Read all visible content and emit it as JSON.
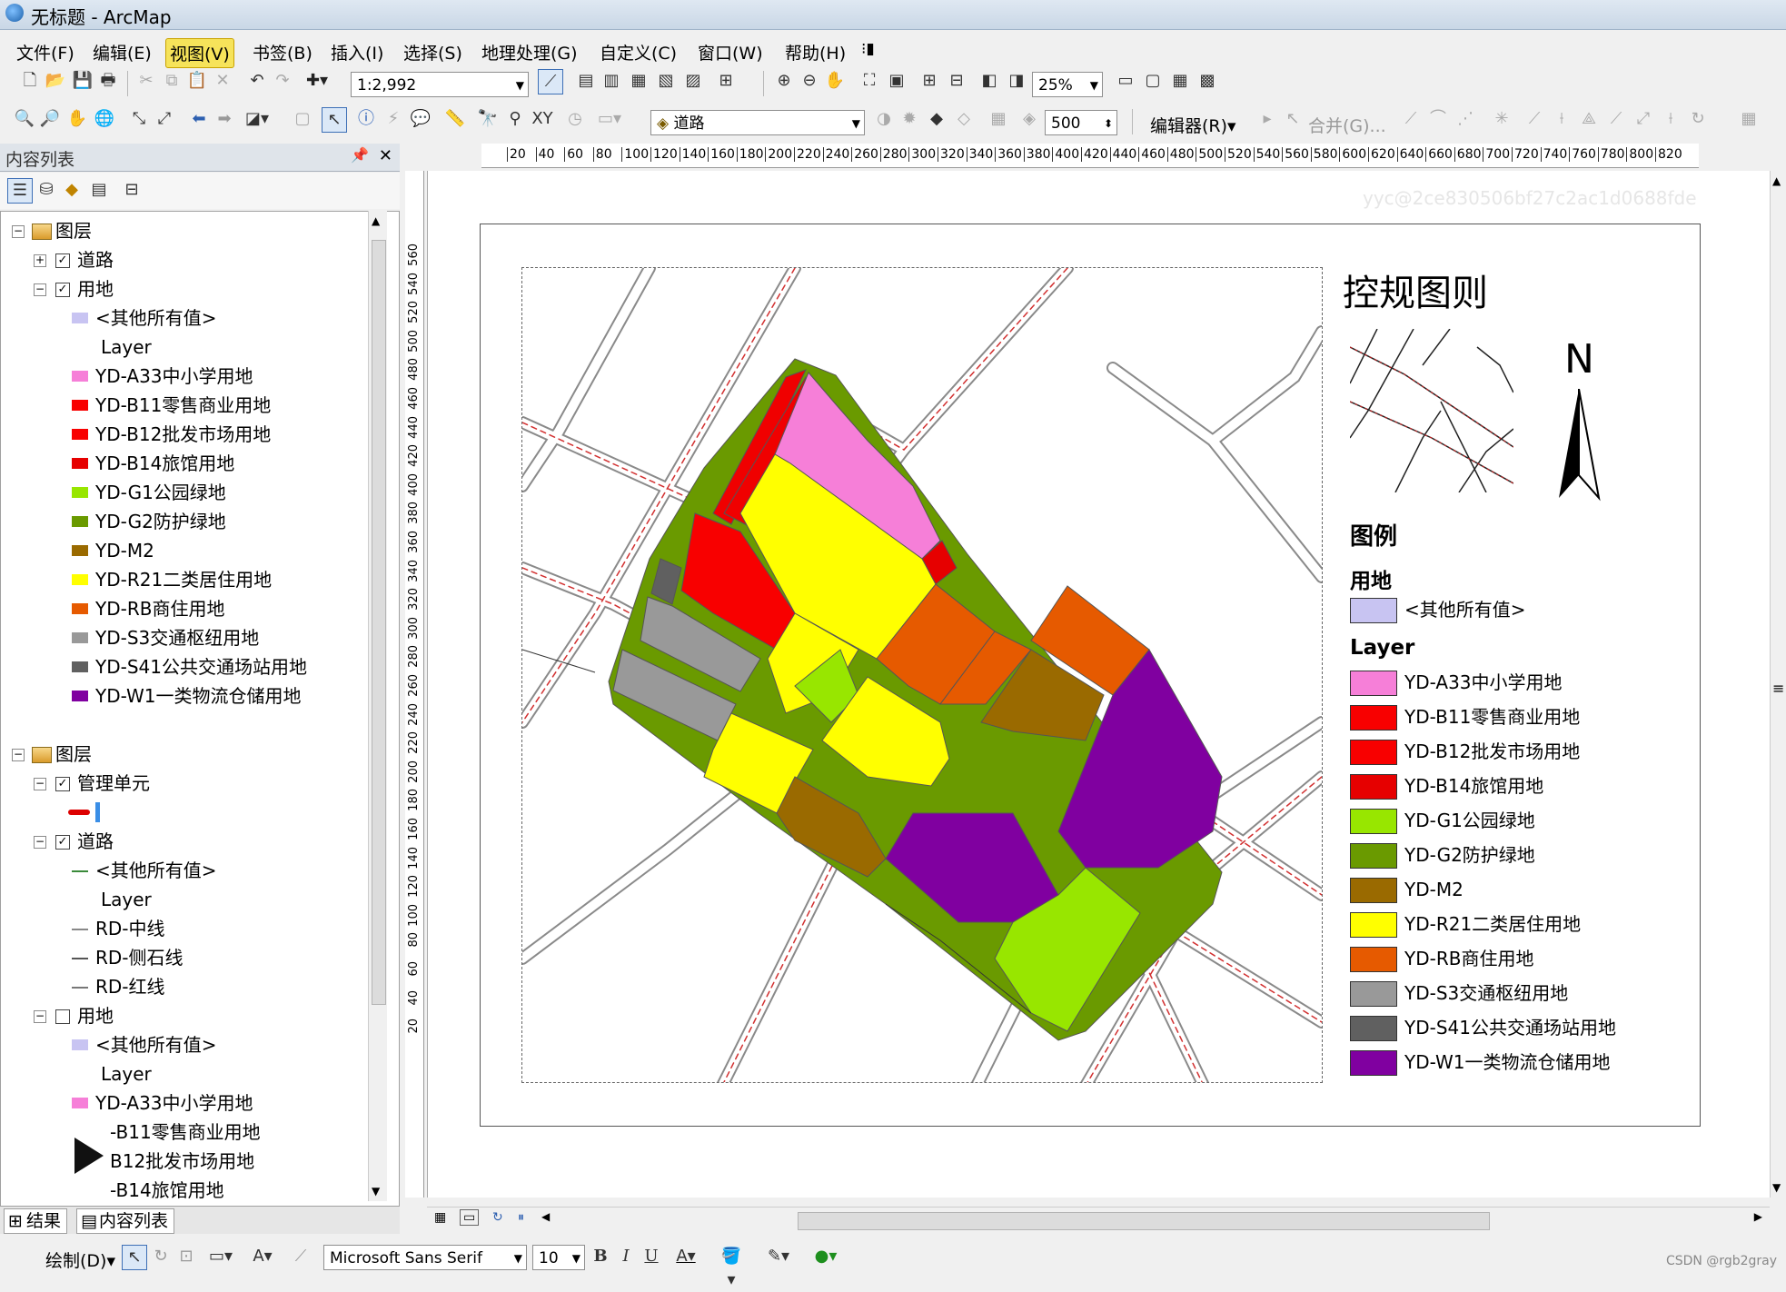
{
  "window": {
    "title": "无标题 - ArcMap"
  },
  "menu": [
    "文件(F)",
    "编辑(E)",
    "视图(V)",
    "书签(B)",
    "插入(I)",
    "选择(S)",
    "地理处理(G)",
    "自定义(C)",
    "窗口(W)",
    "帮助(H)"
  ],
  "menu_active_index": 2,
  "toolbar": {
    "scale": "1:2,992",
    "zoom": "25%",
    "layer_select": "道路",
    "offset_value": "500",
    "editor_label": "编辑器(R)",
    "merge_label": "合并(G)..."
  },
  "toc": {
    "title": "内容列表",
    "rows": [
      {
        "label": "图层",
        "kind": "group",
        "level": 0,
        "expander": "−"
      },
      {
        "label": "道路",
        "kind": "layer",
        "level": 1,
        "expander": "+",
        "checked": true
      },
      {
        "label": "用地",
        "kind": "layer",
        "level": 1,
        "expander": "−",
        "checked": true
      },
      {
        "label": "<其他所有值>",
        "kind": "class",
        "color": "#c8c4f2"
      },
      {
        "label": "Layer",
        "kind": "heading"
      },
      {
        "label": "YD-A33中小学用地",
        "kind": "class",
        "color": "#f67fd8"
      },
      {
        "label": "YD-B11零售商业用地",
        "kind": "class",
        "color": "#f80000"
      },
      {
        "label": "YD-B12批发市场用地",
        "kind": "class",
        "color": "#f80000"
      },
      {
        "label": "YD-B14旅馆用地",
        "kind": "class",
        "color": "#e60000"
      },
      {
        "label": "YD-G1公园绿地",
        "kind": "class",
        "color": "#98e600"
      },
      {
        "label": "YD-G2防护绿地",
        "kind": "class",
        "color": "#6a9a00"
      },
      {
        "label": "YD-M2",
        "kind": "class",
        "color": "#9a6a00"
      },
      {
        "label": "YD-R21二类居住用地",
        "kind": "class",
        "color": "#ffff00"
      },
      {
        "label": "YD-RB商住用地",
        "kind": "class",
        "color": "#e65a00"
      },
      {
        "label": "YD-S3交通枢纽用地",
        "kind": "class",
        "color": "#999999"
      },
      {
        "label": "YD-S41公共交通场站用地",
        "kind": "class",
        "color": "#606060"
      },
      {
        "label": "YD-W1一类物流仓储用地",
        "kind": "class",
        "color": "#8000a0"
      },
      {
        "label": "",
        "kind": "blank"
      },
      {
        "label": "图层",
        "kind": "group",
        "level": 0,
        "expander": "−"
      },
      {
        "label": "管理单元",
        "kind": "layer",
        "level": 1,
        "expander": "−",
        "checked": true
      },
      {
        "label": "",
        "kind": "marker"
      },
      {
        "label": "道路",
        "kind": "layer",
        "level": 1,
        "expander": "−",
        "checked": true
      },
      {
        "label": "<其他所有值>",
        "kind": "line",
        "color": "#3a8a3a"
      },
      {
        "label": "Layer",
        "kind": "heading"
      },
      {
        "label": "RD-中线",
        "kind": "line",
        "color": "#ffffff"
      },
      {
        "label": "RD-侧石线",
        "kind": "line",
        "color": "#555555"
      },
      {
        "label": "RD-红线",
        "kind": "line",
        "color": "#777777"
      },
      {
        "label": "用地",
        "kind": "layer",
        "level": 1,
        "expander": "−",
        "checked": false
      },
      {
        "label": "<其他所有值>",
        "kind": "class",
        "color": "#c8c4f2"
      },
      {
        "label": "Layer",
        "kind": "heading"
      },
      {
        "label": "YD-A33中小学用地",
        "kind": "class",
        "color": "#f67fd8"
      },
      {
        "label": "-B11零售商业用地",
        "kind": "class",
        "color": ""
      },
      {
        "label": "B12批发市场用地",
        "kind": "class",
        "color": ""
      },
      {
        "label": "-B14旅馆用地",
        "kind": "class",
        "color": ""
      }
    ],
    "bottom_tabs": [
      "结果",
      "内容列表"
    ]
  },
  "ruler": {
    "h_ticks": [
      "20",
      "40",
      "60",
      "80",
      "100",
      "120",
      "140",
      "160",
      "180",
      "200",
      "220",
      "240",
      "260",
      "280",
      "300",
      "320",
      "340",
      "360",
      "380",
      "400",
      "420",
      "440",
      "460",
      "480",
      "500",
      "520",
      "540",
      "560",
      "580",
      "600",
      "620",
      "640",
      "660",
      "680",
      "700",
      "720",
      "740",
      "760",
      "780",
      "800",
      "820"
    ],
    "v_ticks": [
      "560",
      "540",
      "520",
      "500",
      "480",
      "460",
      "440",
      "420",
      "400",
      "380",
      "360",
      "340",
      "320",
      "300",
      "280",
      "260",
      "240",
      "220",
      "200",
      "180",
      "160",
      "140",
      "120",
      "100",
      "80",
      "60",
      "40",
      "20"
    ]
  },
  "map": {
    "title": "控规图则",
    "north_label": "N",
    "legend_heading": "图例",
    "legend_group": "用地",
    "legend_other": {
      "label": "<其他所有值>",
      "color": "#c8c4f2"
    },
    "legend_layer_heading": "Layer",
    "legend_items": [
      {
        "label": "YD-A33中小学用地",
        "color": "#f67fd8"
      },
      {
        "label": "YD-B11零售商业用地",
        "color": "#f80000"
      },
      {
        "label": "YD-B12批发市场用地",
        "color": "#f80000"
      },
      {
        "label": "YD-B14旅馆用地",
        "color": "#e60000"
      },
      {
        "label": "YD-G1公园绿地",
        "color": "#98e600"
      },
      {
        "label": "YD-G2防护绿地",
        "color": "#6a9a00"
      },
      {
        "label": "YD-M2",
        "color": "#9a6a00"
      },
      {
        "label": "YD-R21二类居住用地",
        "color": "#ffff00"
      },
      {
        "label": "YD-RB商住用地",
        "color": "#e65a00"
      },
      {
        "label": "YD-S3交通枢纽用地",
        "color": "#999999"
      },
      {
        "label": "YD-S41公共交通场站用地",
        "color": "#606060"
      },
      {
        "label": "YD-W1一类物流仓储用地",
        "color": "#8000a0"
      }
    ],
    "watermark": "yyc@2ce830506bf27c2ac1d0688fde"
  },
  "drawbar": {
    "draw_label": "绘制(D)",
    "font_name": "Microsoft Sans Serif",
    "font_size": "10",
    "bold": "B",
    "italic": "I",
    "underline": "U",
    "text_tool": "A"
  },
  "footer": {
    "credit": "CSDN @rgb2gray"
  }
}
